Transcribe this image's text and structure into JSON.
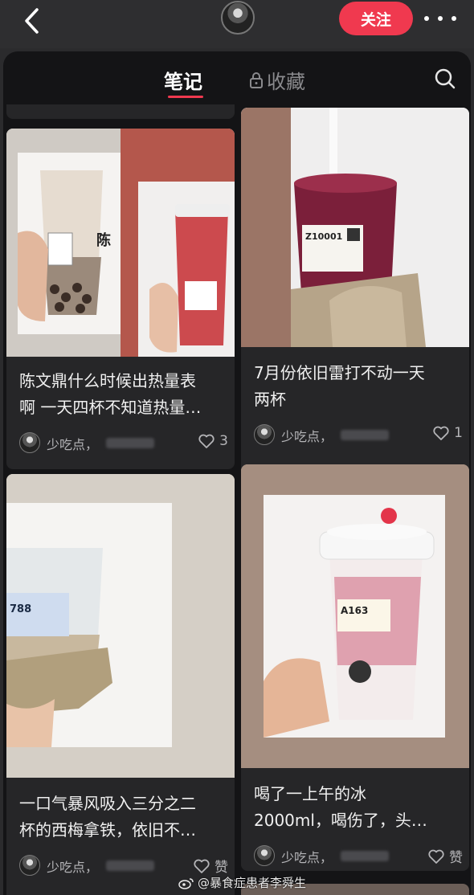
{
  "header": {
    "follow_label": "关注"
  },
  "tabs": {
    "notes": "笔记",
    "favorites": "收藏"
  },
  "notes": [
    {
      "title_line1": "陈文鼎什么时候出热量表",
      "title_line2": "啊 一天四杯不知道热量…",
      "author": "少吃点，",
      "likes": "3"
    },
    {
      "title_line1": "7月份依旧雷打不动一天",
      "title_line2": "两杯",
      "author": "少吃点，",
      "likes": "1"
    },
    {
      "title_line1": "一口气暴风吸入三分之二",
      "title_line2": "杯的西梅拿铁，依旧不…",
      "author": "少吃点，",
      "likes": "赞"
    },
    {
      "title_line1": "喝了一上午的冰",
      "title_line2": "2000ml，喝伤了，头…",
      "author": "少吃点，",
      "likes": "赞"
    }
  ],
  "cup_labels": {
    "z10001": "Z10001",
    "n788": "788",
    "a163": "A163"
  },
  "watermark": "@暴食症患者李舜生",
  "colors": {
    "accent": "#f0394f",
    "panel_bg": "#141416",
    "card_bg": "#262628"
  }
}
